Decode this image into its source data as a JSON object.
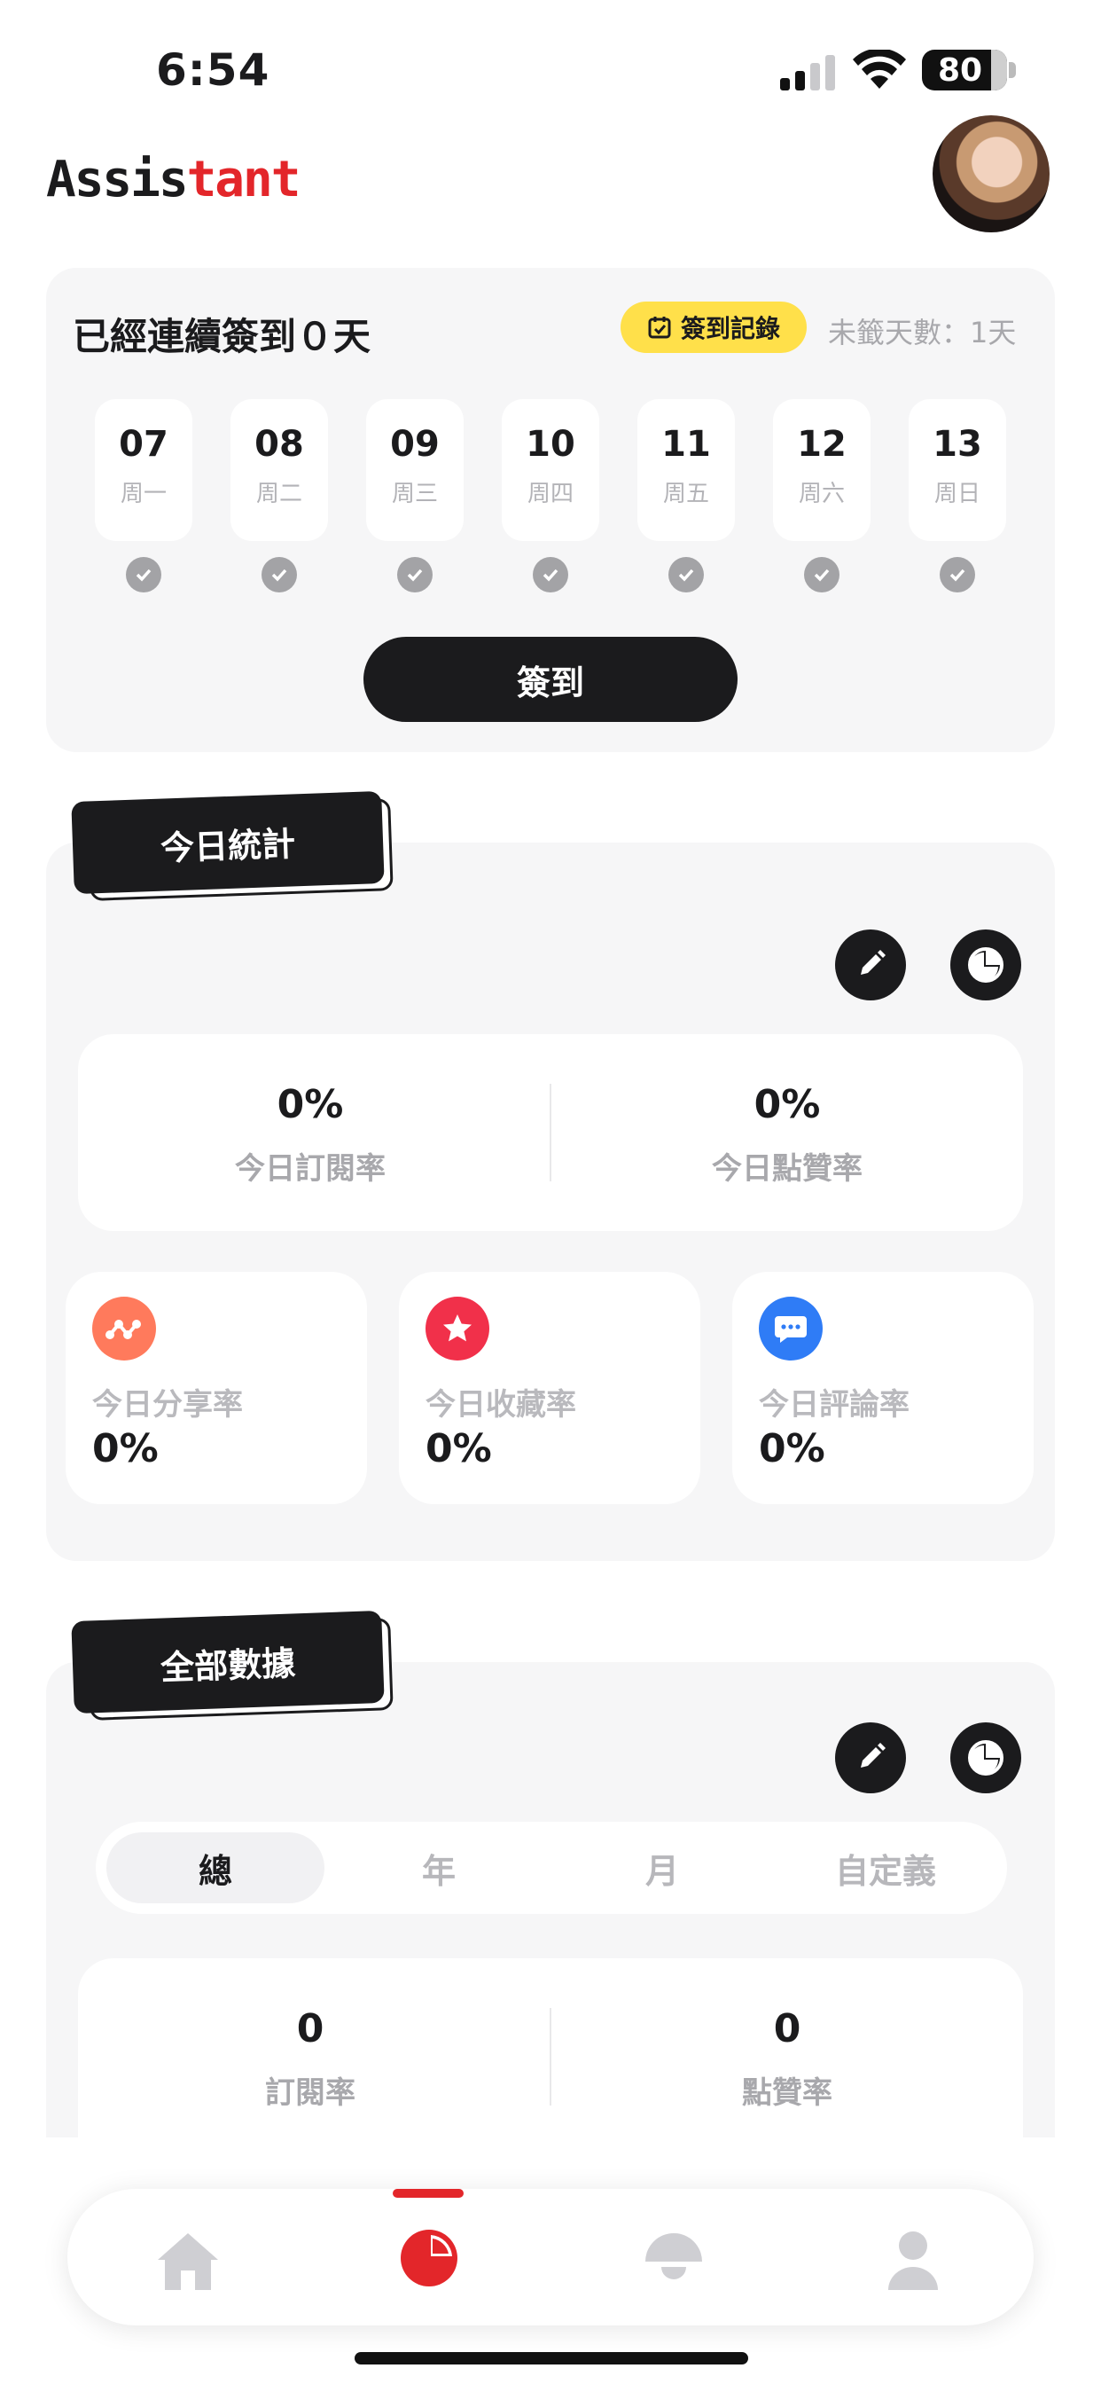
{
  "status_bar": {
    "time": "6:54",
    "battery": "80"
  },
  "header": {
    "logo_dark": "Assis",
    "logo_red": "tant"
  },
  "checkin": {
    "title": "已經連續簽到０天",
    "record_button": "簽到記錄",
    "missed": "未籤天數：1天",
    "days": [
      {
        "num": "07",
        "wk": "周一"
      },
      {
        "num": "08",
        "wk": "周二"
      },
      {
        "num": "09",
        "wk": "周三"
      },
      {
        "num": "10",
        "wk": "周四"
      },
      {
        "num": "11",
        "wk": "周五"
      },
      {
        "num": "12",
        "wk": "周六"
      },
      {
        "num": "13",
        "wk": "周日"
      }
    ],
    "sign_button": "簽到"
  },
  "today": {
    "tag": "今日統計",
    "sub_rate": {
      "value": "0%",
      "label": "今日訂閱率"
    },
    "like_rate": {
      "value": "0%",
      "label": "今日點贊率"
    },
    "share": {
      "value": "0%",
      "label": "今日分享率"
    },
    "fav": {
      "value": "0%",
      "label": "今日收藏率"
    },
    "comment": {
      "value": "0%",
      "label": "今日評論率"
    }
  },
  "all": {
    "tag": "全部數據",
    "tabs": [
      "總",
      "年",
      "月",
      "自定義"
    ],
    "sub_rate": {
      "value": "0",
      "label": "訂閱率"
    },
    "like_rate": {
      "value": "0",
      "label": "點贊率"
    }
  },
  "colors": {
    "accent": "#e3262a",
    "yellow": "#ffe04a",
    "dark": "#1b1b1d"
  },
  "nav": [
    "home-icon",
    "pie-chart-icon",
    "bulb-icon",
    "user-icon"
  ]
}
